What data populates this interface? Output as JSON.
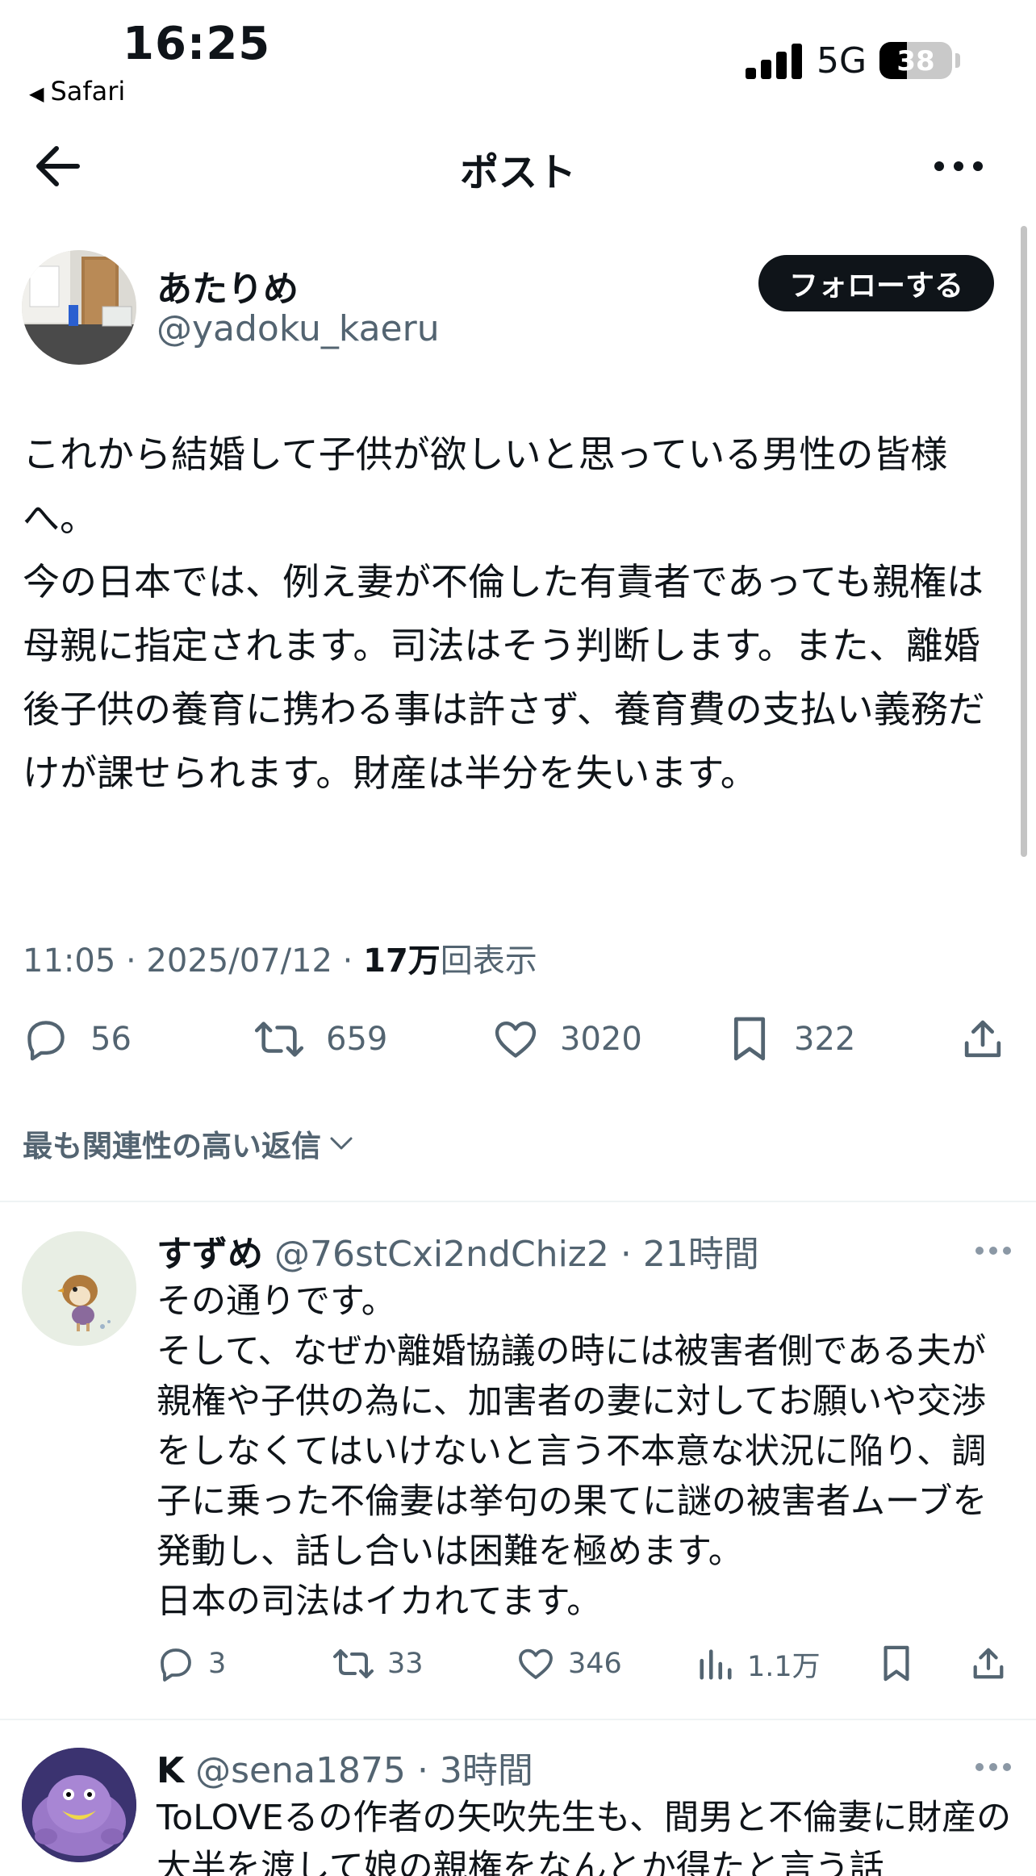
{
  "status_bar": {
    "time": "16:25",
    "back_app": "Safari",
    "network": "5G",
    "battery_level": 38,
    "battery_text": "38"
  },
  "nav": {
    "title": "ポスト",
    "back_icon": "arrow-left-icon",
    "more_icon": "more-horizontal-icon"
  },
  "post": {
    "author_name": "あたりめ",
    "author_handle": "@yadoku_kaeru",
    "follow_label": "フォローする",
    "text": "これから結婚して子供が欲しいと思っている男性の皆様へ。\n今の日本では、例え妻が不倫した有責者であっても親権は母親に指定されます。司法はそう判断します。また、離婚後子供の養育に携わる事は許さず、養育費の支払い義務だけが課せられます。財産は半分を失います。",
    "timestamp": "11:05 · 2025/07/12 · ",
    "views_count": "17万",
    "views_label": "回表示",
    "stats": {
      "replies": "56",
      "reposts": "659",
      "likes": "3020",
      "bookmarks": "322"
    }
  },
  "replies_sort_label": "最も関連性の高い返信",
  "replies": [
    {
      "name": "すずめ",
      "handle": "@76stCxi2ndChiz2",
      "time": "· 21時間",
      "text": "その通りです。\nそして、なぜか離婚協議の時には被害者側である夫が親権や子供の為に、加害者の妻に対してお願いや交渉をしなくてはいけないと言う不本意な状況に陥り、調子に乗った不倫妻は挙句の果てに謎の被害者ムーブを発動し、話し合いは困難を極めます。\n日本の司法はイカれてます。",
      "stats": {
        "replies": "3",
        "reposts": "33",
        "likes": "346",
        "views": "1.1万"
      }
    },
    {
      "name": "K",
      "handle": "@sena1875",
      "time": "· 3時間",
      "text": "ToLOVEるの作者の矢吹先生も、間男と不倫妻に財産の大半を渡して娘の親権をなんとか得たと言う話"
    }
  ],
  "colors": {
    "text": "#0f1419",
    "secondary": "#536471",
    "divider": "#eff3f4",
    "follow_bg": "#0f1419"
  }
}
